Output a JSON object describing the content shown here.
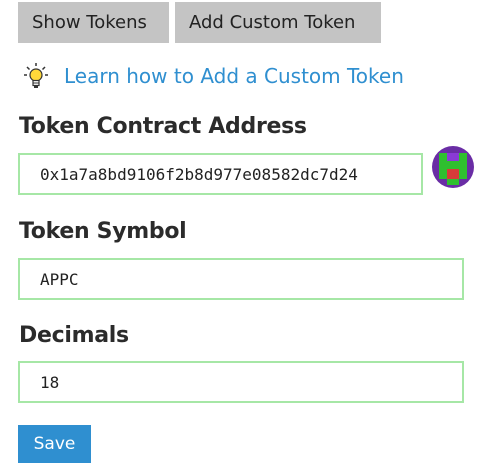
{
  "tabs": {
    "show_tokens": "Show Tokens",
    "add_custom_token": "Add Custom Token"
  },
  "learn": {
    "icon": "lightbulb-icon",
    "link_text": "Learn how to Add a Custom Token"
  },
  "form": {
    "contract_address": {
      "label": "Token Contract Address",
      "value": "0x1a7a8bd9106f2b8d977e08582dc7d24"
    },
    "symbol": {
      "label": "Token Symbol",
      "value": "APPC"
    },
    "decimals": {
      "label": "Decimals",
      "value": "18"
    },
    "save_label": "Save"
  },
  "identicon": {
    "icon": "token-identicon",
    "colors": [
      "#6a2da5",
      "#2fbf2f",
      "#d63a3a",
      "#8a3ad6"
    ]
  },
  "colors": {
    "tab_bg": "#c4c4c4",
    "link": "#2f8fd0",
    "input_border": "#a6e7a6",
    "primary_button": "#2f8fd0"
  }
}
